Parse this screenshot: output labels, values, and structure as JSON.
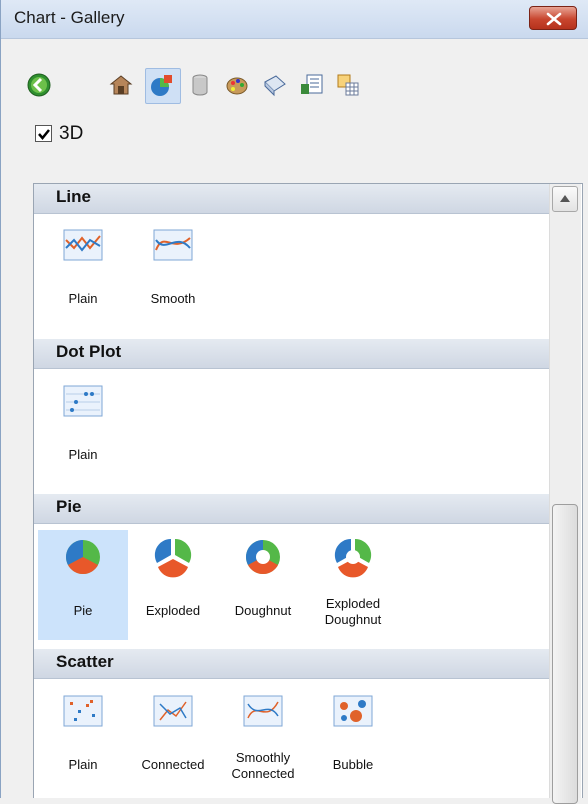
{
  "window": {
    "title": "Chart - Gallery"
  },
  "toolbar": {
    "icons": [
      "back-icon",
      "house-icon",
      "chart-gallery-icon",
      "cylinder-icon",
      "palette-icon",
      "plane-icon",
      "form-icon",
      "table-icon"
    ]
  },
  "options": {
    "three_d_label": "3D",
    "three_d_checked": true
  },
  "gallery": {
    "sections": [
      {
        "title": "Line",
        "items": [
          {
            "label": "Plain"
          },
          {
            "label": "Smooth"
          }
        ]
      },
      {
        "title": "Dot Plot",
        "items": [
          {
            "label": "Plain"
          }
        ]
      },
      {
        "title": "Pie",
        "items": [
          {
            "label": "Pie",
            "selected": true
          },
          {
            "label": "Exploded"
          },
          {
            "label": "Doughnut"
          },
          {
            "label1": "Exploded",
            "label2": "Doughnut"
          }
        ]
      },
      {
        "title": "Scatter",
        "items": [
          {
            "label": "Plain"
          },
          {
            "label": "Connected"
          },
          {
            "label1": "Smoothly",
            "label2": "Connected"
          },
          {
            "label": "Bubble"
          }
        ]
      }
    ]
  },
  "colors": {
    "selection": "#cce3fb",
    "header": "#d7dee8",
    "close": "#c8462f"
  }
}
